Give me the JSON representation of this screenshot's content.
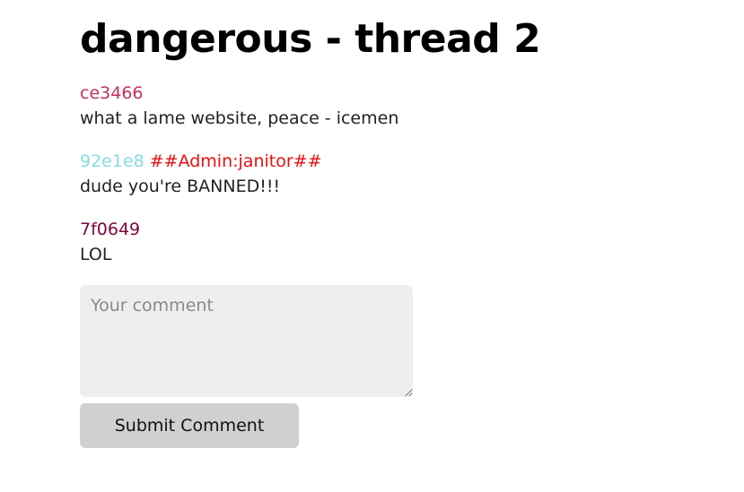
{
  "thread": {
    "title": "dangerous - thread 2"
  },
  "comments": [
    {
      "author": "ce3466",
      "author_color": "#c2305d",
      "badge": "",
      "text": "what a lame website, peace - icemen"
    },
    {
      "author": "92e1e8",
      "author_color": "#86dbe4",
      "badge": "##Admin:janitor##",
      "badge_color": "#e81010",
      "text": "dude you're BANNED!!!"
    },
    {
      "author": "7f0649",
      "author_color": "#7a0640",
      "badge": "",
      "text": "LOL"
    }
  ],
  "form": {
    "comment_placeholder": "Your comment",
    "comment_value": "",
    "submit_label": "Submit Comment"
  }
}
